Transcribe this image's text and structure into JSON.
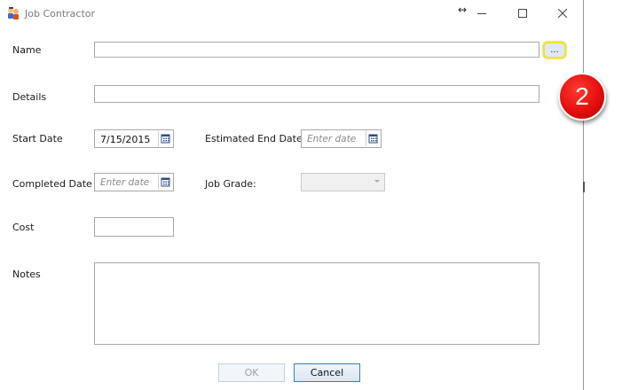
{
  "window": {
    "title": "Job Contractor",
    "resize_glyph": "↔",
    "minimize_glyph": "—",
    "maximize_glyph": "☐",
    "close_glyph": "✕"
  },
  "form": {
    "name_label": "Name",
    "name_value": "",
    "name_browse_label": "...",
    "details_label": "Details",
    "details_value": "",
    "start_date_label": "Start Date",
    "start_date_value": "7/15/2015",
    "est_end_date_label": "Estimated End Date",
    "est_end_date_placeholder": "Enter date",
    "completed_date_label": "Completed Date",
    "completed_date_placeholder": "Enter date",
    "job_grade_label": "Job Grade:",
    "job_grade_value": "",
    "cost_label": "Cost",
    "cost_value": "",
    "notes_label": "Notes",
    "notes_value": ""
  },
  "buttons": {
    "ok_label": "OK",
    "cancel_label": "Cancel"
  },
  "annotation": {
    "step_number": "2",
    "highlight_color": "#f2e51a",
    "badge_color": "#e40f0f"
  },
  "icons": [
    "app-icon",
    "resize-icon",
    "minimize-icon",
    "maximize-icon",
    "close-icon",
    "calendar-icon"
  ]
}
